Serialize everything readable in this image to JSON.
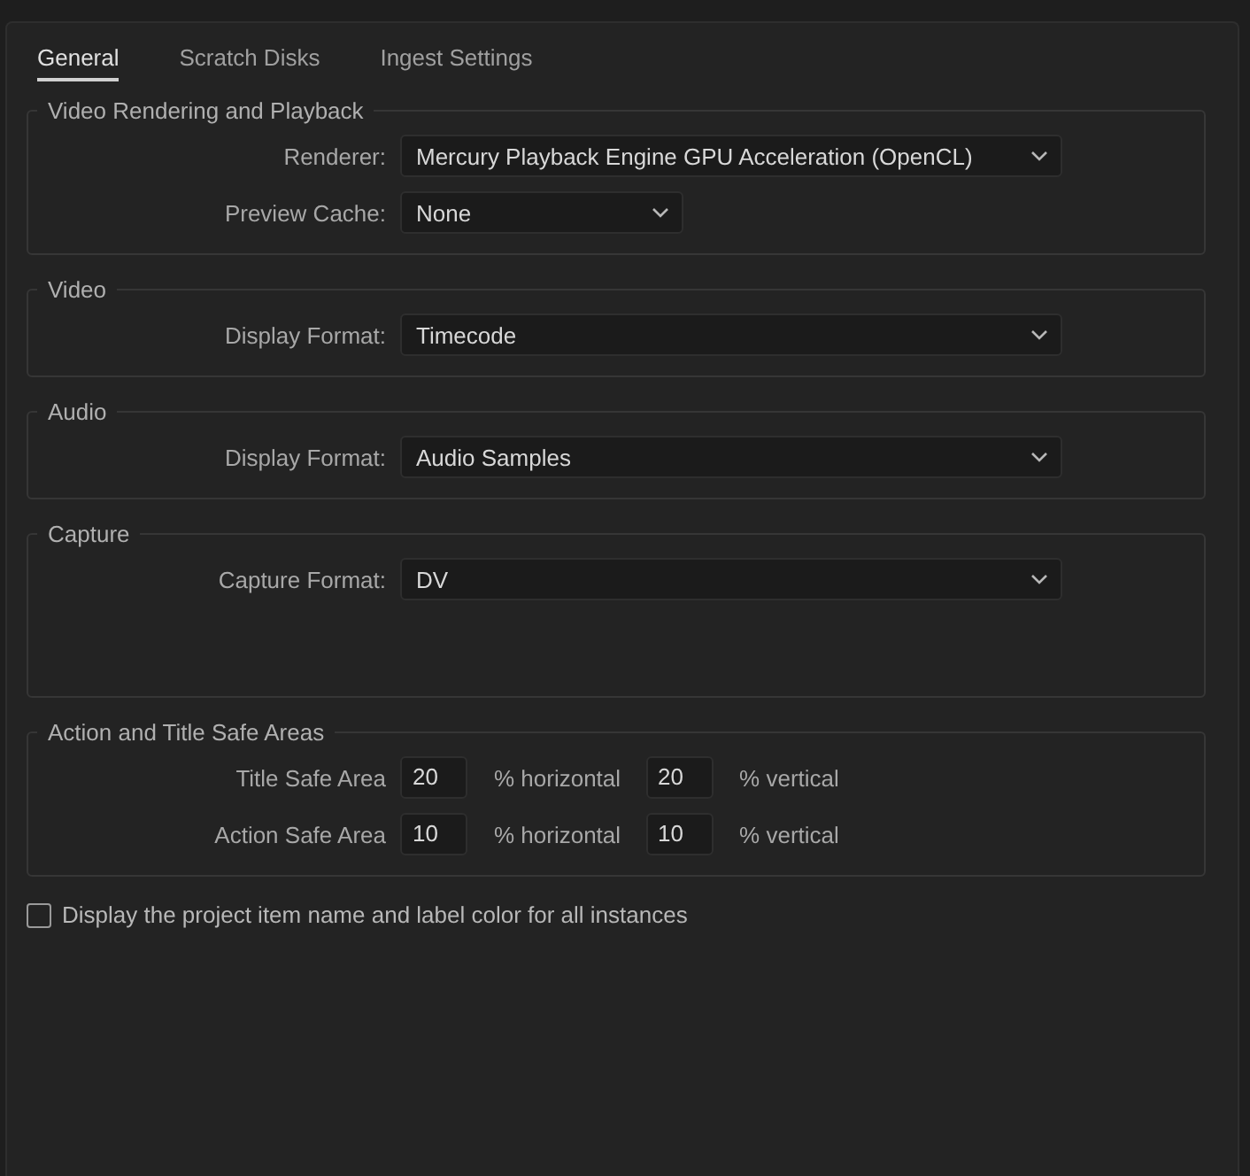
{
  "tabs": [
    {
      "label": "General",
      "selected": true
    },
    {
      "label": "Scratch Disks",
      "selected": false
    },
    {
      "label": "Ingest Settings",
      "selected": false
    }
  ],
  "groups": [
    {
      "title": "Video Rendering and Playback",
      "kind": "dropdowns",
      "rows": [
        {
          "label": "Renderer:",
          "value": "Mercury Playback Engine GPU Acceleration (OpenCL)",
          "kind": "wide"
        },
        {
          "label": "Preview Cache:",
          "value": "None",
          "kind": "short"
        }
      ]
    },
    {
      "title": "Video",
      "kind": "dropdowns",
      "rows": [
        {
          "label": "Display Format:",
          "value": "Timecode",
          "kind": "wide"
        }
      ]
    },
    {
      "title": "Audio",
      "kind": "dropdowns",
      "rows": [
        {
          "label": "Display Format:",
          "value": "Audio Samples",
          "kind": "wide"
        }
      ]
    },
    {
      "title": "Capture",
      "kind": "dropdowns-tall",
      "rows": [
        {
          "label": "Capture Format:",
          "value": "DV",
          "kind": "wide"
        }
      ]
    },
    {
      "title": "Action and Title Safe Areas",
      "kind": "safe-areas",
      "rows": [
        {
          "label": "Title Safe Area",
          "horizontal": "20",
          "horizontal_unit": "% horizontal",
          "vertical": "20",
          "vertical_unit": "% vertical"
        },
        {
          "label": "Action Safe Area",
          "horizontal": "10",
          "horizontal_unit": "% horizontal",
          "vertical": "10",
          "vertical_unit": "% vertical"
        }
      ]
    }
  ],
  "checkbox": {
    "label": "Display the project item name and label color for all instances",
    "checked": false
  }
}
